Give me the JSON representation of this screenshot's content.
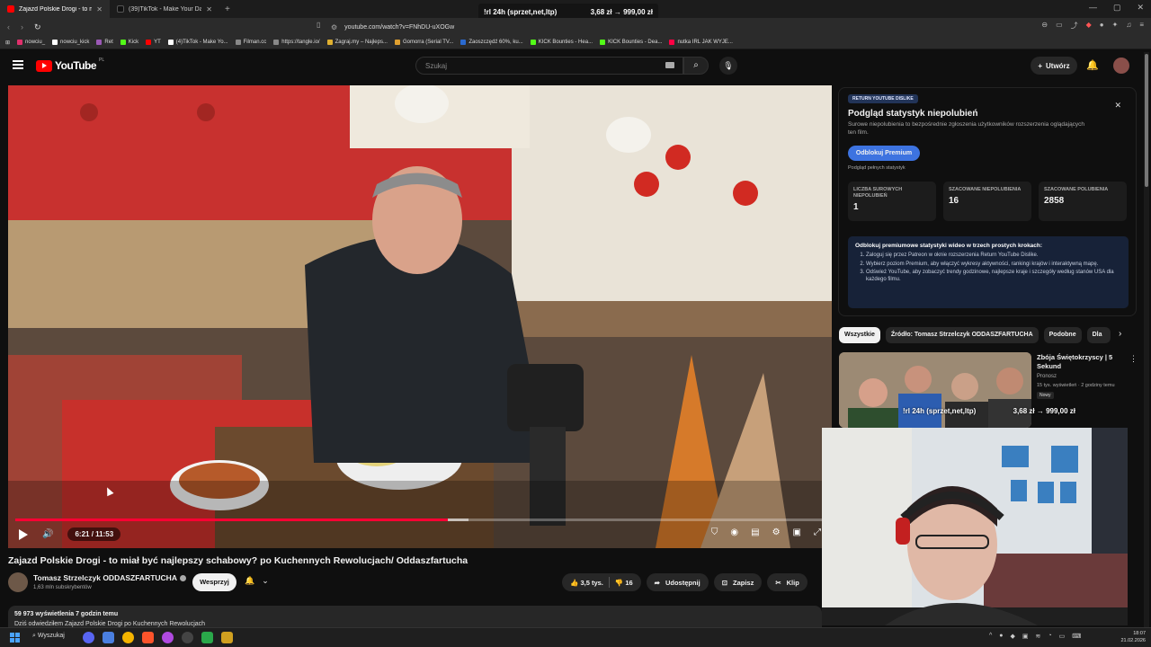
{
  "browser": {
    "tabs": [
      {
        "label": "Zajazd Polskie Drogi - to miał być",
        "color": "#ff0000",
        "active": true
      },
      {
        "label": "(39)TikTok - Make Your Day",
        "color": "#222222",
        "active": false
      }
    ],
    "address": "youtube.com/watch?v=FNhDU-uXOGw",
    "overlay_left": "!rl 24h (sprzet,net,ltp)",
    "overlay_right": "3,68 zł → 999,00 zł"
  },
  "bookmarks": [
    {
      "label": "nowciu_",
      "color": "#e1306c"
    },
    {
      "label": "nowciu_kick",
      "color": "#ffffff"
    },
    {
      "label": "Ret",
      "color": "#9b59b6"
    },
    {
      "label": "Kick",
      "color": "#53fc18"
    },
    {
      "label": "YT",
      "color": "#ff0000"
    },
    {
      "label": "(4)TikTok - Make Yo...",
      "color": "#ffffff"
    },
    {
      "label": "Filman.cc",
      "color": "#888888"
    },
    {
      "label": "https://tangle.io/",
      "color": "#888888"
    },
    {
      "label": "Zagraj.my – Najleps...",
      "color": "#e0b030"
    },
    {
      "label": "Gomorra (Serial TV...",
      "color": "#e0a030"
    },
    {
      "label": "Zaoszczędź 60%, ku...",
      "color": "#2a6ad0"
    },
    {
      "label": "KICK Bounties - Hea...",
      "color": "#53fc18"
    },
    {
      "label": "KICK Bounties - Dea...",
      "color": "#53fc18"
    },
    {
      "label": "nutka IRL JAK WYJE...",
      "color": "#ff0044"
    }
  ],
  "youtube": {
    "logo_text": "YouTube",
    "country": "PL",
    "search_placeholder": "Szukaj",
    "create_label": "Utwórz"
  },
  "player": {
    "time": "6:21 / 11:53",
    "progress": 0.534,
    "buffered": 0.56
  },
  "video": {
    "title": "Zajazd Polskie Drogi - to miał być najlepszy schabowy? po Kuchennych Rewolucjach/ Oddaszfartucha",
    "channel": "Tomasz Strzelczyk ODDASZFARTUCHA",
    "subscribers": "1,63 mln subskrybentów",
    "support_label": "Wesprzyj",
    "likes": "3,5 tys.",
    "dislikes": "16",
    "share_label": "Udostępnij",
    "save_label": "Zapisz",
    "clip_label": "Klip",
    "views_line": "59 973 wyświetlenia  7 godzin temu",
    "desc_line": "Dziś odwiedziłem Zajazd Polskie Drogi po Kuchennych Rewolucjach"
  },
  "ryd": {
    "tag": "RETURN YOUTUBE DISLIKE",
    "title": "Podgląd statystyk niepolubień",
    "description": "Surowe niepolubienia to bezpośrednie zgłoszenia użytkowników rozszerzenia oglądających ten film.",
    "button": "Odblokuj Premium",
    "small": "Podgląd pełnych statystyk",
    "stats": [
      {
        "label": "LICZBA SUROWYCH NIEPOLUBIEŃ",
        "value": "1"
      },
      {
        "label": "SZACOWANE NIEPOLUBIENIA",
        "value": "16"
      },
      {
        "label": "SZACOWANE POLUBIENIA",
        "value": "2858"
      }
    ],
    "steps_heading": "Odblokuj premiumowe statystyki wideo w trzech prostych krokach:",
    "steps": [
      "Zaloguj się przez Patreon w oknie rozszerzenia Return YouTube Dislike.",
      "Wybierz poziom Premium, aby włączyć wykresy aktywności, rankingi krajów i interaktywną mapę.",
      "Odśwież YouTube, aby zobaczyć trendy godzinowe, najlepsze kraje i szczegóły według stanów USA dla każdego filmu."
    ]
  },
  "chips": [
    "Wszystkie",
    "Źródło: Tomasz Strzelczyk ODDASZFARTUCHA",
    "Podobne",
    "Dla"
  ],
  "recommendation": {
    "title": "Zbója Świętokrzyscy | 5 Sekund",
    "channel": "Pronosz",
    "meta": "15 tys. wyświetleń · 2 godziny temu",
    "badge": "Nowy"
  },
  "overlay_mid_left": "!rl 24h (sprzet,net,ltp)",
  "overlay_mid_right": "3,68 zł → 999,00 zł",
  "taskbar": {
    "search": "Wyszukaj",
    "time": "18:07",
    "date": "21.02.2026"
  }
}
